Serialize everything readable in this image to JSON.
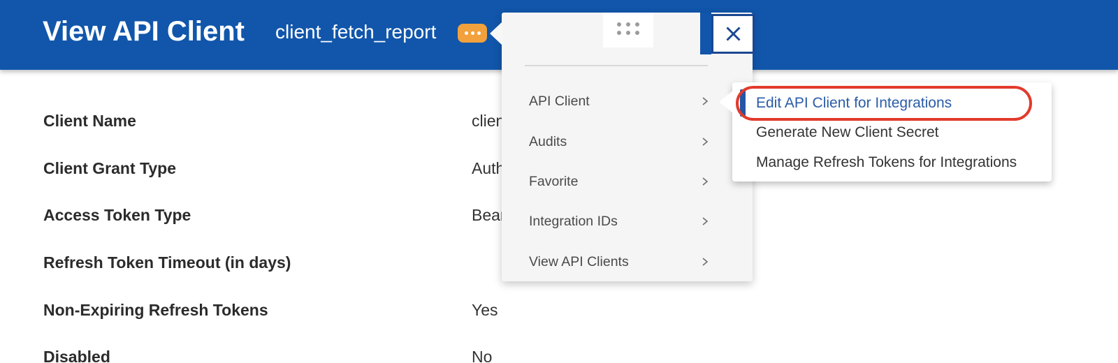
{
  "header": {
    "title": "View API Client",
    "subtitle": "client_fetch_report"
  },
  "fields": [
    {
      "label": "Client Name",
      "value": "client_fetch_report"
    },
    {
      "label": "Client Grant Type",
      "value": "Authorization Code Grant"
    },
    {
      "label": "Access Token Type",
      "value": "Bearer"
    },
    {
      "label": "Refresh Token Timeout (in days)",
      "value": ""
    },
    {
      "label": "Non-Expiring Refresh Tokens",
      "value": "Yes"
    },
    {
      "label": "Disabled",
      "value": "No"
    }
  ],
  "related_actions_menu": {
    "items": [
      {
        "label": "API Client"
      },
      {
        "label": "Audits"
      },
      {
        "label": "Favorite"
      },
      {
        "label": "Integration IDs"
      },
      {
        "label": "View API Clients"
      }
    ]
  },
  "submenu": {
    "items": [
      {
        "label": "Edit API Client for Integrations"
      },
      {
        "label": "Generate New Client Secret"
      },
      {
        "label": "Manage Refresh Tokens for Integrations"
      }
    ]
  },
  "close_button": {
    "label": "✕"
  },
  "colors": {
    "header_blue": "#1156ab",
    "accent_orange": "#f2a13c",
    "navy": "#1b4791",
    "link_blue": "#2b5ca7",
    "annotation_red": "#e23a2c"
  }
}
